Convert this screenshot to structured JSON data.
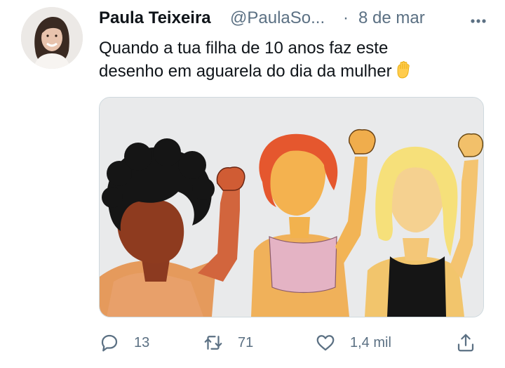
{
  "tweet": {
    "author_name": "Paula Teixeira",
    "author_handle": "@PaulaSo...",
    "separator": "·",
    "date": "8 de mar",
    "text_line1": "Quando a tua filha de 10 anos faz este",
    "text_line2": "desenho em aguarela do dia da mulher",
    "emoji": "raised-fist-emoji",
    "media_description_icon": "watercolor-drawing-image"
  },
  "actions": {
    "reply_count": "13",
    "retweet_count": "71",
    "like_count": "1,4 mil",
    "reply_icon": "reply-icon",
    "retweet_icon": "retweet-icon",
    "like_icon": "heart-icon",
    "share_icon": "share-icon"
  },
  "colors": {
    "text": "#0f1419",
    "secondary": "#5b7083",
    "border": "#cfd9de"
  }
}
